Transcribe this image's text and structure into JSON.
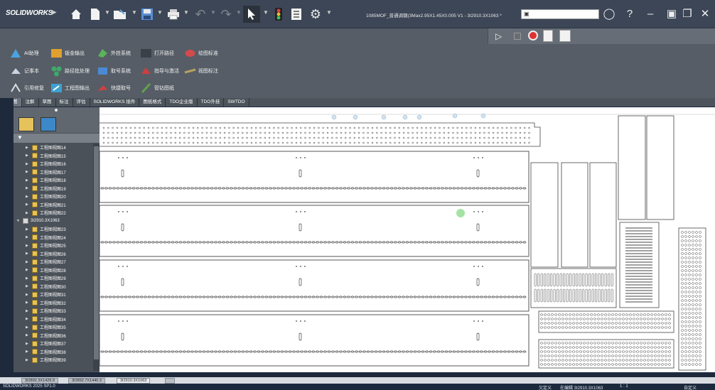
{
  "app": {
    "logo": "SOLIDWORKS",
    "document_title": "1085MOF_普通调钢(3Max2.95X1.45X0.005 V1 - 3I2910.3X1063 *"
  },
  "toolbar": {
    "icons": [
      "home-icon",
      "new-document-icon",
      "open-icon",
      "save-icon",
      "print-icon",
      "undo-icon",
      "redo-icon",
      "select-icon",
      "traffic-light-icon",
      "options-list-icon",
      "gear-icon"
    ]
  },
  "window": {
    "search_placeholder": "",
    "buttons": [
      "user-icon",
      "help-icon",
      "minimize-icon",
      "restore-icon",
      "maximize-icon",
      "close-icon"
    ]
  },
  "ribbon": {
    "row1": [
      {
        "label": "AI助理",
        "icon": "ai-assistant-icon",
        "color": "#4aa3df"
      },
      {
        "label": "钣金输出",
        "icon": "sheet-metal-icon",
        "color": "#e0a030"
      },
      {
        "label": "外挂系统",
        "icon": "plugin-icon",
        "color": "#5bb35b"
      },
      {
        "label": "打开路径",
        "icon": "folder-path-icon",
        "color": "#444b53"
      },
      {
        "label": "绘图标准",
        "icon": "drawing-standard-icon",
        "color": "#d24a4a"
      }
    ],
    "row2": [
      {
        "label": "记事本",
        "icon": "notepad-icon",
        "color": "#7aa0c8"
      },
      {
        "label": "路径批处理",
        "icon": "batch-icon",
        "color": "#3fa86b"
      },
      {
        "label": "取号系统",
        "icon": "number-system-icon",
        "color": "#4a8ad4"
      },
      {
        "label": "指导与激活",
        "icon": "guide-icon",
        "color": "#c94040"
      },
      {
        "label": "视图标注",
        "icon": "view-annotation-icon",
        "color": "#b8a060"
      }
    ],
    "row3": [
      {
        "label": "引用修复",
        "icon": "reference-fix-icon",
        "color": "#888"
      },
      {
        "label": "工程图输出",
        "icon": "drawing-output-icon",
        "color": "#3fa0d0"
      },
      {
        "label": "快捷取号",
        "icon": "quick-number-icon",
        "color": "#d04040"
      },
      {
        "label": "管钻图纸",
        "icon": "pipe-drill-icon",
        "color": "#60a050"
      }
    ],
    "macro_buttons": [
      "run-icon",
      "stop-icon",
      "record-icon",
      "edit-macro-icon",
      "new-macro-icon"
    ]
  },
  "tabs": [
    "工程图",
    "注解",
    "草图",
    "标注",
    "评估",
    "SOLIDWORKS 插件",
    "图纸格式",
    "TDO企业版",
    "TDO外挂",
    "SWTDO"
  ],
  "tree": {
    "group1": [
      "工程图视图14",
      "工程图视图15",
      "工程图视图16",
      "工程图视图17",
      "工程图视图18",
      "工程图视图19",
      "工程图视图20",
      "工程图视图21",
      "工程图视图22"
    ],
    "sheet": "3I2910.3X1063",
    "group2": [
      "工程图视图23",
      "工程图视图24",
      "工程图视图25",
      "工程图视图26",
      "工程图视图27",
      "工程图视图28",
      "工程图视图29",
      "工程图视图30",
      "工程图视图31",
      "工程图视图32",
      "工程图视图33",
      "工程图视图34",
      "工程图视图35",
      "工程图视图36",
      "工程图视图37",
      "工程图视图38",
      "工程图视图39"
    ]
  },
  "sheet_tabs": [
    "3I2892.3X1429.9",
    "3I2892.7X1440.3",
    "3I2910.3X1063"
  ],
  "status": {
    "app_version": "SOLIDWORKS 2025 SP1.0",
    "custom_1": "欠定义",
    "editing": "在编辑 3I2910.3X1063",
    "scale": "1 : 1",
    "custom_2": "自定义"
  }
}
